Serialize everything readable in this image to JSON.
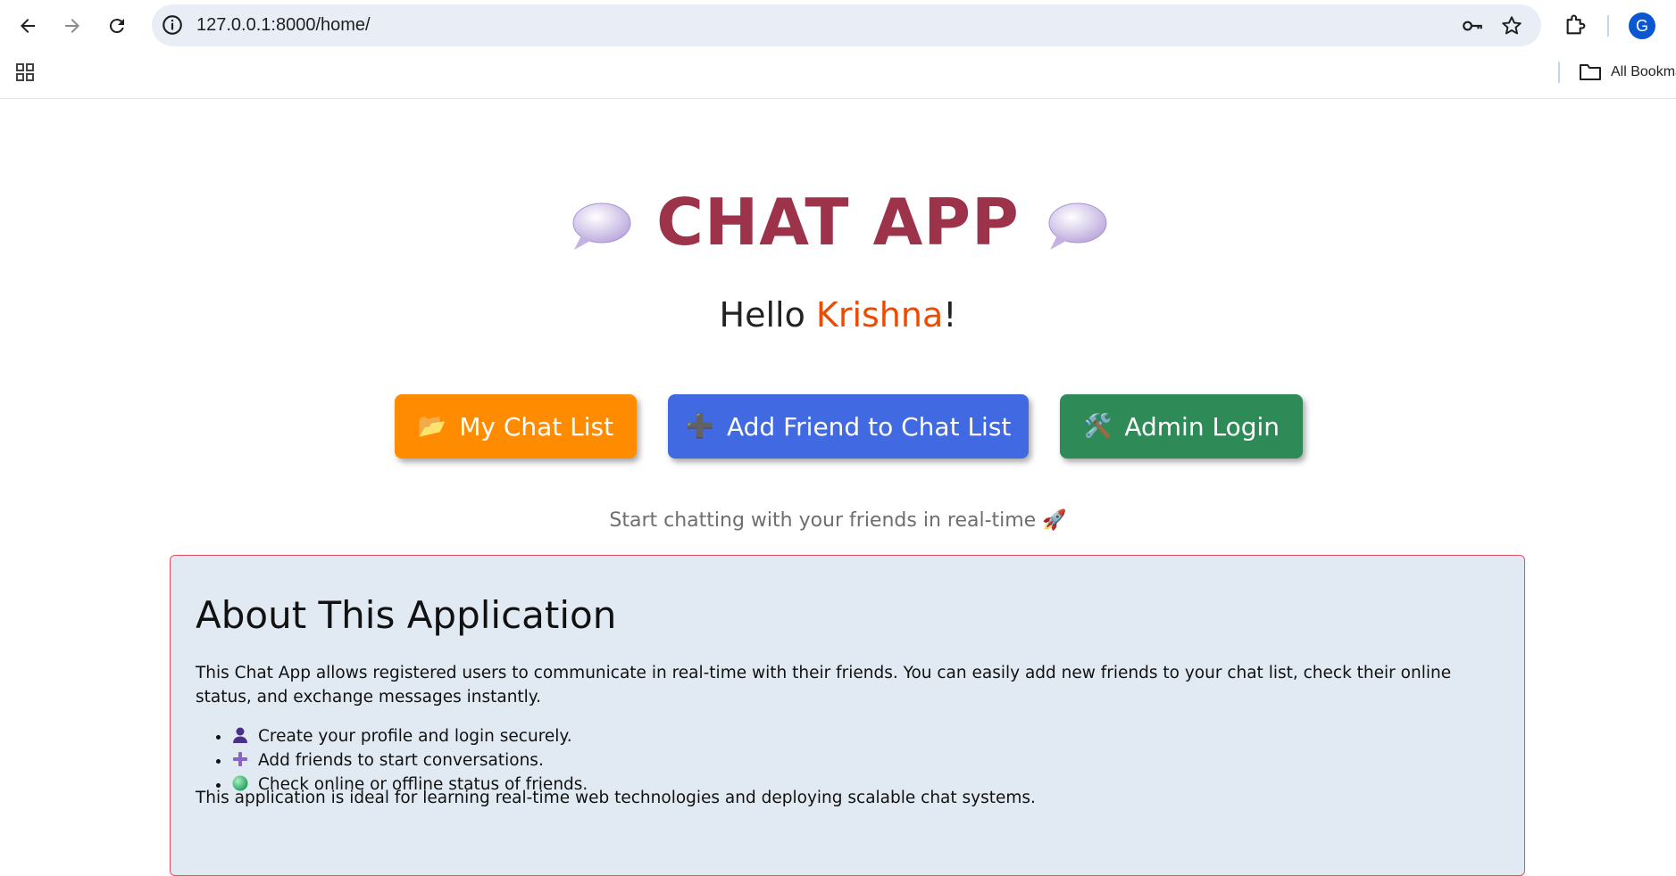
{
  "browser": {
    "url": "127.0.0.1:8000/home/",
    "profile_initial": "G",
    "bookmarks_label": "All Bookma"
  },
  "page": {
    "title": "CHAT APP",
    "greeting_prefix": "Hello ",
    "user_name": "Krishna",
    "greeting_suffix": "!",
    "buttons": [
      {
        "label": "My Chat List",
        "icon": "📂",
        "color": "#ff8c00"
      },
      {
        "label": "Add Friend to Chat List",
        "icon": "➕",
        "color": "#4169e1"
      },
      {
        "label": "Admin Login",
        "icon": "🛠️",
        "color": "#2e8b57"
      }
    ],
    "tagline": "Start chatting with your friends in real-time 🚀"
  },
  "about": {
    "heading": "About This Application",
    "intro": "This Chat App allows registered users to communicate in real-time with their friends. You can easily add new friends to your chat list, check their online status, and exchange messages instantly.",
    "features": [
      "Create your profile and login securely.",
      "Add friends to start conversations.",
      "Check online or offline status of friends."
    ],
    "closing": "This application is ideal for learning real-time web technologies and deploying scalable chat systems."
  },
  "colors": {
    "title": "#9c334b",
    "user_name": "#f04a00",
    "about_bg": "#e1eaf3",
    "about_border": "#e05060"
  }
}
